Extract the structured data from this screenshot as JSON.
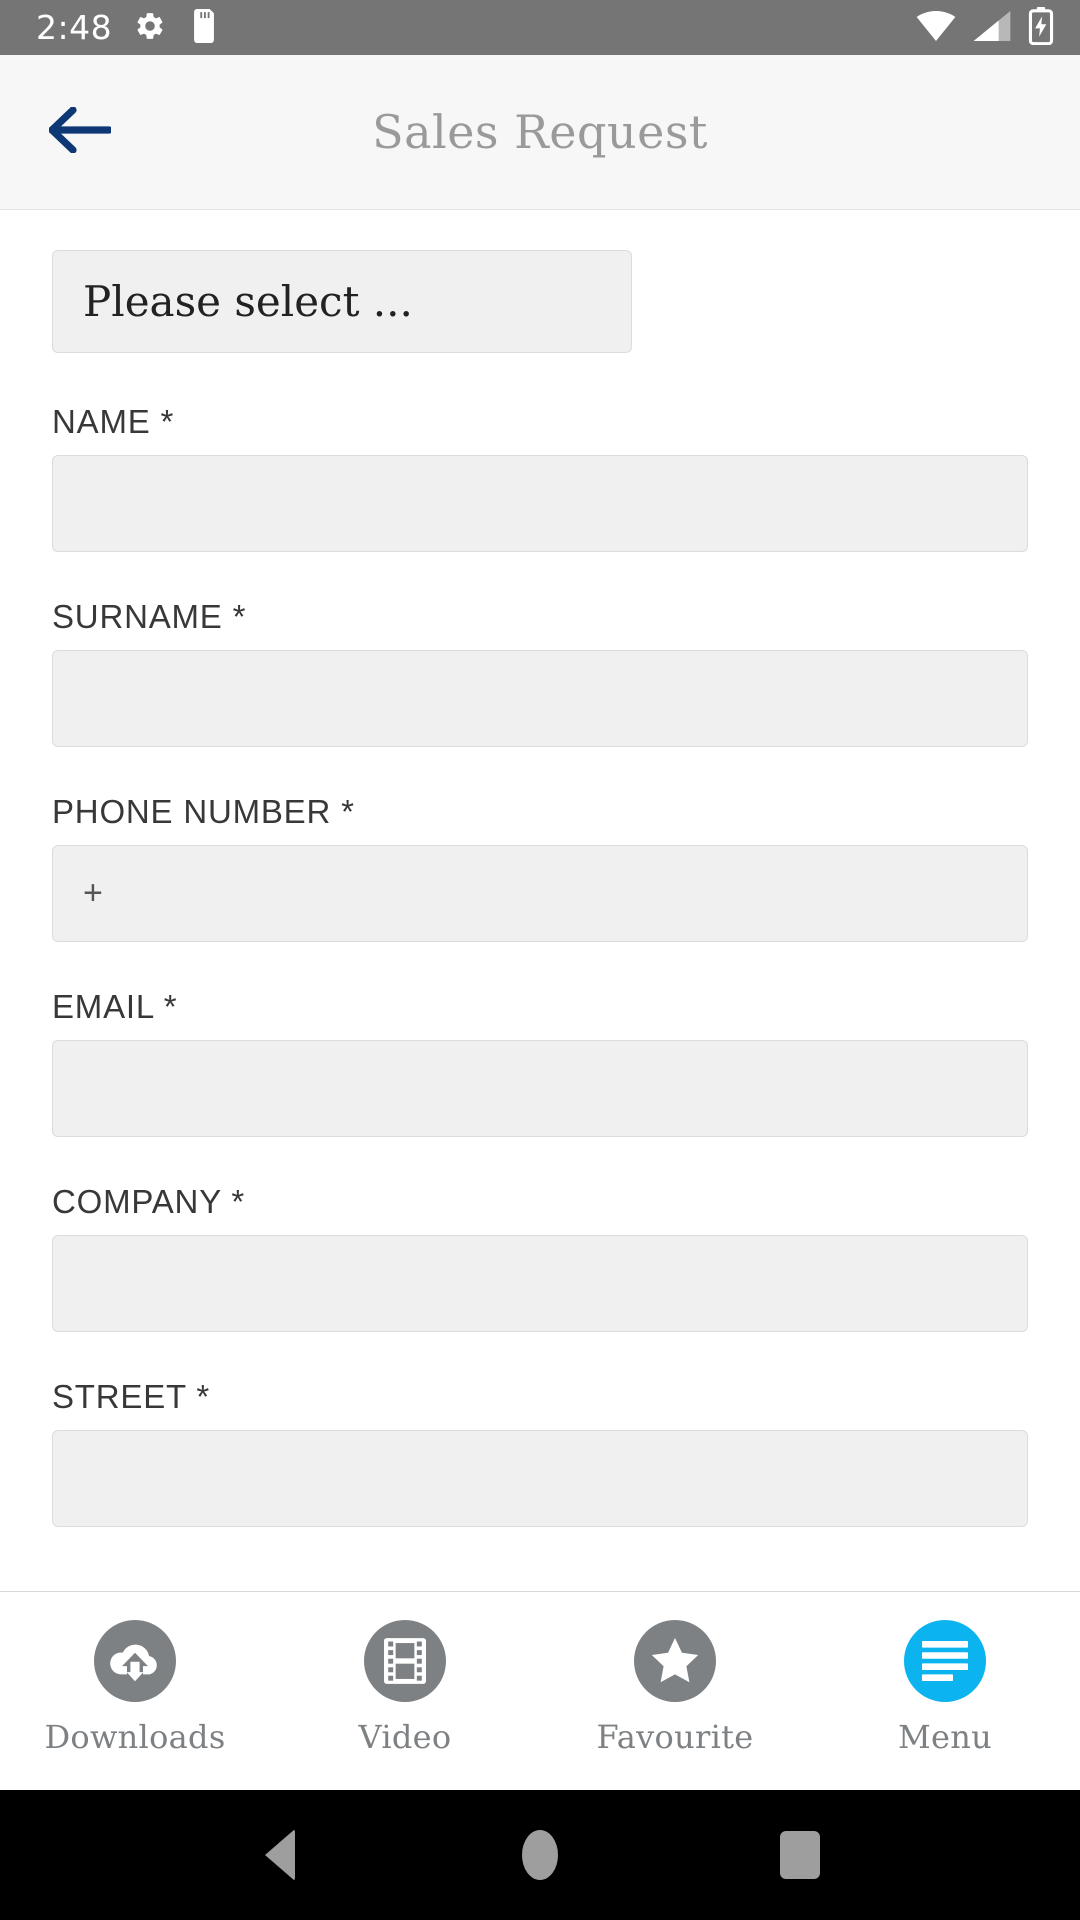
{
  "status_bar": {
    "clock": "2:48",
    "left_icons": [
      "gear-icon",
      "sd-card-icon"
    ],
    "right_icons": [
      "wifi-icon",
      "cellular-signal-icon",
      "battery-charging-icon"
    ],
    "background_color": "#757575"
  },
  "header": {
    "title": "Sales Request",
    "back_icon": "arrow-left-icon",
    "back_icon_color": "#0d3875",
    "title_color": "#9a9a9a",
    "background_color": "#f7f7f7"
  },
  "form": {
    "category_select": {
      "value": "Please select ...",
      "placeholder": "Please select ..."
    },
    "fields": [
      {
        "label": "NAME *",
        "value": "",
        "placeholder": ""
      },
      {
        "label": "SURNAME *",
        "value": "",
        "placeholder": ""
      },
      {
        "label": "PHONE NUMBER *",
        "value": "+",
        "placeholder": ""
      },
      {
        "label": "EMAIL *",
        "value": "",
        "placeholder": ""
      },
      {
        "label": "COMPANY *",
        "value": "",
        "placeholder": ""
      },
      {
        "label": "STREET *",
        "value": "",
        "placeholder": ""
      }
    ]
  },
  "tab_bar": {
    "items": [
      {
        "label": "Downloads",
        "icon": "cloud-download-icon",
        "active": false
      },
      {
        "label": "Video",
        "icon": "film-strip-icon",
        "active": false
      },
      {
        "label": "Favourite",
        "icon": "star-icon",
        "active": false
      },
      {
        "label": "Menu",
        "icon": "hamburger-menu-icon",
        "active": true
      }
    ],
    "inactive_color": "#7d8184",
    "active_color": "#0bb4ef"
  },
  "android_nav": {
    "buttons": [
      "back-triangle-icon",
      "home-circle-icon",
      "recents-square-icon"
    ],
    "icon_color": "#9e9e9e",
    "background_color": "#000000"
  }
}
